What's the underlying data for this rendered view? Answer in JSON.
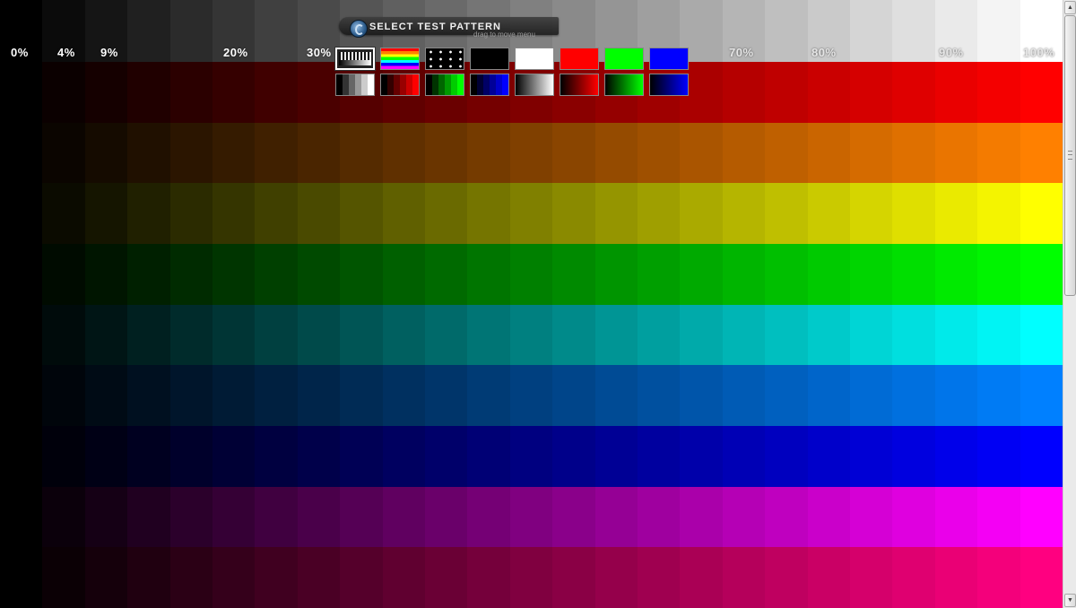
{
  "menu": {
    "title": "SELECT TEST PATTERN",
    "hint": "drag to move menu",
    "thumbnails_row1": [
      {
        "name": "grayscale-steps",
        "kind": "steps"
      },
      {
        "name": "color-gradient-bars",
        "kind": "rainbow"
      },
      {
        "name": "dot-grid",
        "kind": "dots"
      },
      {
        "name": "solid-black",
        "kind": "solid",
        "color": "#000000"
      },
      {
        "name": "solid-white",
        "kind": "solid",
        "color": "#ffffff"
      },
      {
        "name": "solid-red",
        "kind": "solid",
        "color": "#ff0000"
      },
      {
        "name": "solid-green",
        "kind": "solid",
        "color": "#00ff00"
      },
      {
        "name": "solid-blue",
        "kind": "solid",
        "color": "#0000ff"
      }
    ],
    "thumbnails_row2": [
      {
        "name": "white-steps",
        "kind": "steps-color",
        "color": "#ffffff"
      },
      {
        "name": "red-steps",
        "kind": "steps-color",
        "color": "#ff0000"
      },
      {
        "name": "green-steps",
        "kind": "steps-color",
        "color": "#00ff00"
      },
      {
        "name": "blue-steps",
        "kind": "steps-color",
        "color": "#0000ff"
      },
      {
        "name": "white-gradient",
        "kind": "gradient",
        "color": "#ffffff"
      },
      {
        "name": "red-gradient",
        "kind": "gradient",
        "color": "#ff0000"
      },
      {
        "name": "green-gradient",
        "kind": "gradient",
        "color": "#00ff00"
      },
      {
        "name": "blue-gradient",
        "kind": "gradient",
        "color": "#0000ff"
      }
    ],
    "selected_index": 0
  },
  "pattern": {
    "columns": 25,
    "percent_labels": [
      "0%",
      "4%",
      "9%",
      "20%",
      "30%",
      "70%",
      "80%",
      "90%",
      "100%"
    ],
    "rows": [
      {
        "name": "red",
        "color": "#ff0000"
      },
      {
        "name": "orange",
        "color": "#ff8000"
      },
      {
        "name": "yellow",
        "color": "#ffff00"
      },
      {
        "name": "green",
        "color": "#00ff00"
      },
      {
        "name": "cyan",
        "color": "#00ffff"
      },
      {
        "name": "azure",
        "color": "#0080ff"
      },
      {
        "name": "blue",
        "color": "#0000ff"
      },
      {
        "name": "magenta",
        "color": "#ff00ff"
      },
      {
        "name": "rose",
        "color": "#ff0080"
      }
    ]
  },
  "scrollbar": {
    "up_icon": "arrow-up-icon",
    "down_icon": "arrow-down-icon",
    "grip_icon": "grip-icon"
  }
}
